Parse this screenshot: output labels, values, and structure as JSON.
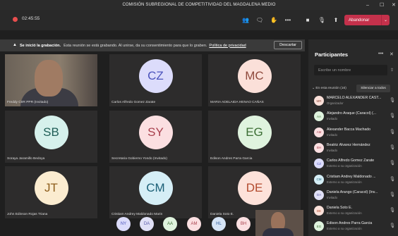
{
  "window": {
    "title": "COMISIÓN SUBREGIONAL DE COMPETITIVIDAD DEL MAGDALENA MEDIO",
    "minimize": "–",
    "maximize": "☐",
    "close": "✕"
  },
  "toolbar": {
    "timer": "02:45:55",
    "hangup_label": "Abandonar",
    "hangup_chevron": "⌄",
    "icons": {
      "participants": "👥",
      "chat": "🗨",
      "raise_hand": "✋",
      "more": "•••",
      "camera": "■",
      "mic": "🎙",
      "share": "⬆"
    }
  },
  "banner": {
    "bold": "Se inició la grabación.",
    "text": "Esta reunión se está grabando. Al unirse, da su consentimiento para que lo graben.",
    "link": "Política de privacidad",
    "dismiss": "Descartar",
    "warn_icon": "▲"
  },
  "tiles": [
    {
      "name": "Freddy CIIR PPR (Invitado)",
      "video": true
    },
    {
      "initials": "CZ",
      "name": "Carlos Alfredo Gomez Zarate",
      "bg": "#dcdcfb",
      "fg": "#4b53bc"
    },
    {
      "initials": "MC",
      "name": "MARIA ADELAIDA HENAO CAÑAS",
      "bg": "#fbe0d9",
      "fg": "#8f4a3d"
    },
    {
      "initials": "SB",
      "name": "Soraya Jaramillo Bedoya",
      "bg": "#d6f1ec",
      "fg": "#205e57"
    },
    {
      "initials": "SY",
      "name": "Secretaria Gobierno Yondo (Invitado)",
      "bg": "#fbdfe1",
      "fg": "#a8404d"
    },
    {
      "initials": "EG",
      "name": "Edison Andres Parra Garcia",
      "bg": "#dff3de",
      "fg": "#3c6e34"
    },
    {
      "initials": "JT",
      "name": "John Edinson Rojas Triana",
      "bg": "#fbecd0",
      "fg": "#8e5e1c"
    },
    {
      "initials": "CM",
      "name": "Cristiam Andrey Maldonado Marin",
      "bg": "#d5eef6",
      "fg": "#1c6077"
    },
    {
      "initials": "DE",
      "name": "Daniela Soto E.",
      "bg": "#fde2da",
      "fg": "#b24a2d"
    }
  ],
  "mini_avatars": [
    {
      "initials": "NY",
      "bg": "#dcdcfb",
      "fg": "#4b53bc"
    },
    {
      "initials": "DA",
      "bg": "#e0e0f6",
      "fg": "#5a5aa8"
    },
    {
      "initials": "AA",
      "bg": "#dff3de",
      "fg": "#3c6e34"
    },
    {
      "initials": "AM",
      "bg": "#fbdfe1",
      "fg": "#a8404d"
    },
    {
      "initials": "HL",
      "bg": "#d5e4f6",
      "fg": "#2d5c9a"
    },
    {
      "initials": "BH",
      "bg": "#fbdfe1",
      "fg": "#a8404d"
    }
  ],
  "panel": {
    "title": "Participantes",
    "more": "•••",
    "close": "✕",
    "search_placeholder": "Escribe un nombre",
    "section_label": "En esta reunión (16)",
    "silence_button": "Silenciar a todos",
    "participants": [
      {
        "initials": "MR",
        "name": "MARCELO ALEXANDER CAST...",
        "role": "Organizador",
        "bg": "#fbe0d9",
        "fg": "#8f4a3d"
      },
      {
        "initials": "AA",
        "name": "Alejandro Araque (Caracol) (...",
        "role": "Invitado",
        "bg": "#dff3de",
        "fg": "#3c6e34"
      },
      {
        "initials": "AM",
        "name": "Alexander Bacca Machado",
        "role": "Invitado",
        "bg": "#fbdfe1",
        "fg": "#a8404d"
      },
      {
        "initials": "BH",
        "name": "Beatriz Álvarez Hernández",
        "role": "Invitado",
        "bg": "#fbdfe1",
        "fg": "#a8404d"
      },
      {
        "initials": "CZ",
        "name": "Carlos Alfredo Gomez Zarate",
        "role": "Externo a su organización",
        "bg": "#dcdcfb",
        "fg": "#4b53bc"
      },
      {
        "initials": "CM",
        "name": "Cristiam Andrey Maldonado ...",
        "role": "Externo a su organización",
        "bg": "#d5eef6",
        "fg": "#1c6077"
      },
      {
        "initials": "DA",
        "name": "Daniela Arango (Caracol) (Inv...",
        "role": "Invitado",
        "bg": "#e0e0f6",
        "fg": "#5a5aa8"
      },
      {
        "initials": "DE",
        "name": "Daniela Soto E.",
        "role": "Externo a su organización",
        "bg": "#fde2da",
        "fg": "#b24a2d"
      },
      {
        "initials": "EG",
        "name": "Edison Andres Parra Garcia",
        "role": "Externo a su organización",
        "bg": "#dff3de",
        "fg": "#3c6e34"
      }
    ],
    "mic_icon": "🎙"
  }
}
